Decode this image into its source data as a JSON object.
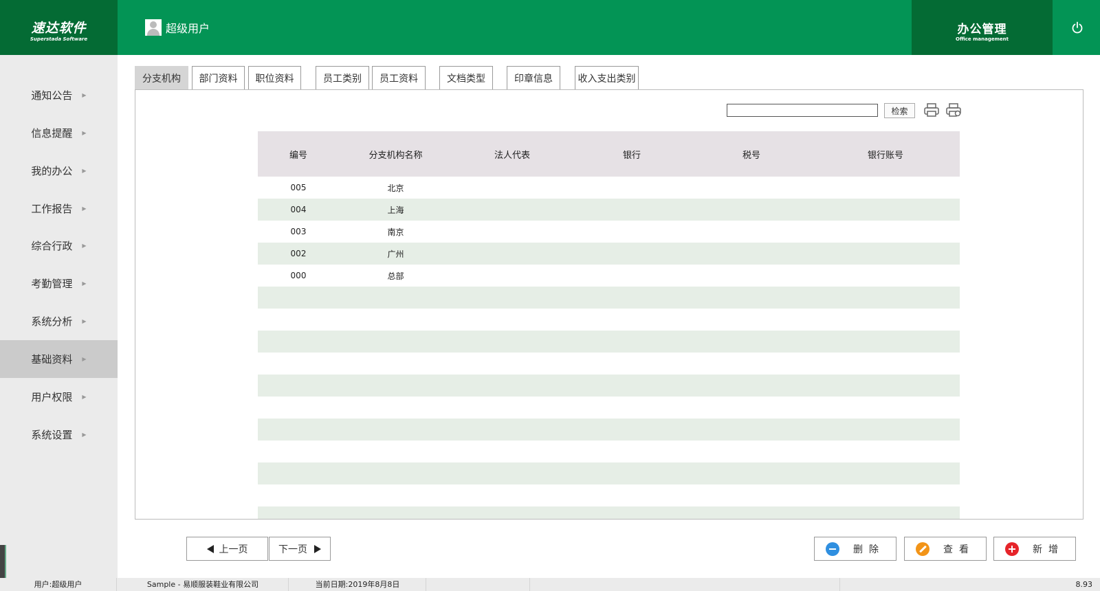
{
  "header": {
    "logo_cn": "速达软件",
    "logo_en": "Superstada Software",
    "user_name": "超级用户",
    "office_cn": "办公管理",
    "office_en": "Office management",
    "power_icon": "power-icon"
  },
  "sidebar": {
    "items": [
      {
        "label": "通知公告"
      },
      {
        "label": "信息提醒"
      },
      {
        "label": "我的办公"
      },
      {
        "label": "工作报告"
      },
      {
        "label": "综合行政"
      },
      {
        "label": "考勤管理"
      },
      {
        "label": "系统分析"
      },
      {
        "label": "基础资料",
        "active": true
      },
      {
        "label": "用户权限"
      },
      {
        "label": "系统设置"
      }
    ]
  },
  "tabs": [
    {
      "label": "分支机构",
      "active": true
    },
    {
      "label": "部门资料"
    },
    {
      "label": "职位资料"
    },
    {
      "label": "员工类别"
    },
    {
      "label": "员工资料"
    },
    {
      "label": "文档类型"
    },
    {
      "label": "印章信息"
    },
    {
      "label": "收入支出类别"
    }
  ],
  "search": {
    "value": "",
    "button_label": "检索"
  },
  "table": {
    "headers": [
      "编号",
      "分支机构名称",
      "法人代表",
      "银行",
      "税号",
      "银行账号"
    ],
    "rows": [
      [
        "005",
        "北京",
        "",
        "",
        "",
        ""
      ],
      [
        "004",
        "上海",
        "",
        "",
        "",
        ""
      ],
      [
        "003",
        "南京",
        "",
        "",
        "",
        ""
      ],
      [
        "002",
        "广州",
        "",
        "",
        "",
        ""
      ],
      [
        "000",
        "总部",
        "",
        "",
        "",
        ""
      ]
    ]
  },
  "pagination": {
    "prev_label": "上一页",
    "next_label": "下一页"
  },
  "actions": {
    "delete_label": "删除",
    "view_label": "查看",
    "add_label": "新增",
    "colors": {
      "delete": "#2f8fe0",
      "view": "#f29418",
      "add": "#e6242a"
    }
  },
  "status_bar": {
    "user": "用户:超级用户",
    "company": "Sample - 易顺服装鞋业有限公司",
    "date": "当前日期:2019年8月8日",
    "version": "8.93"
  }
}
